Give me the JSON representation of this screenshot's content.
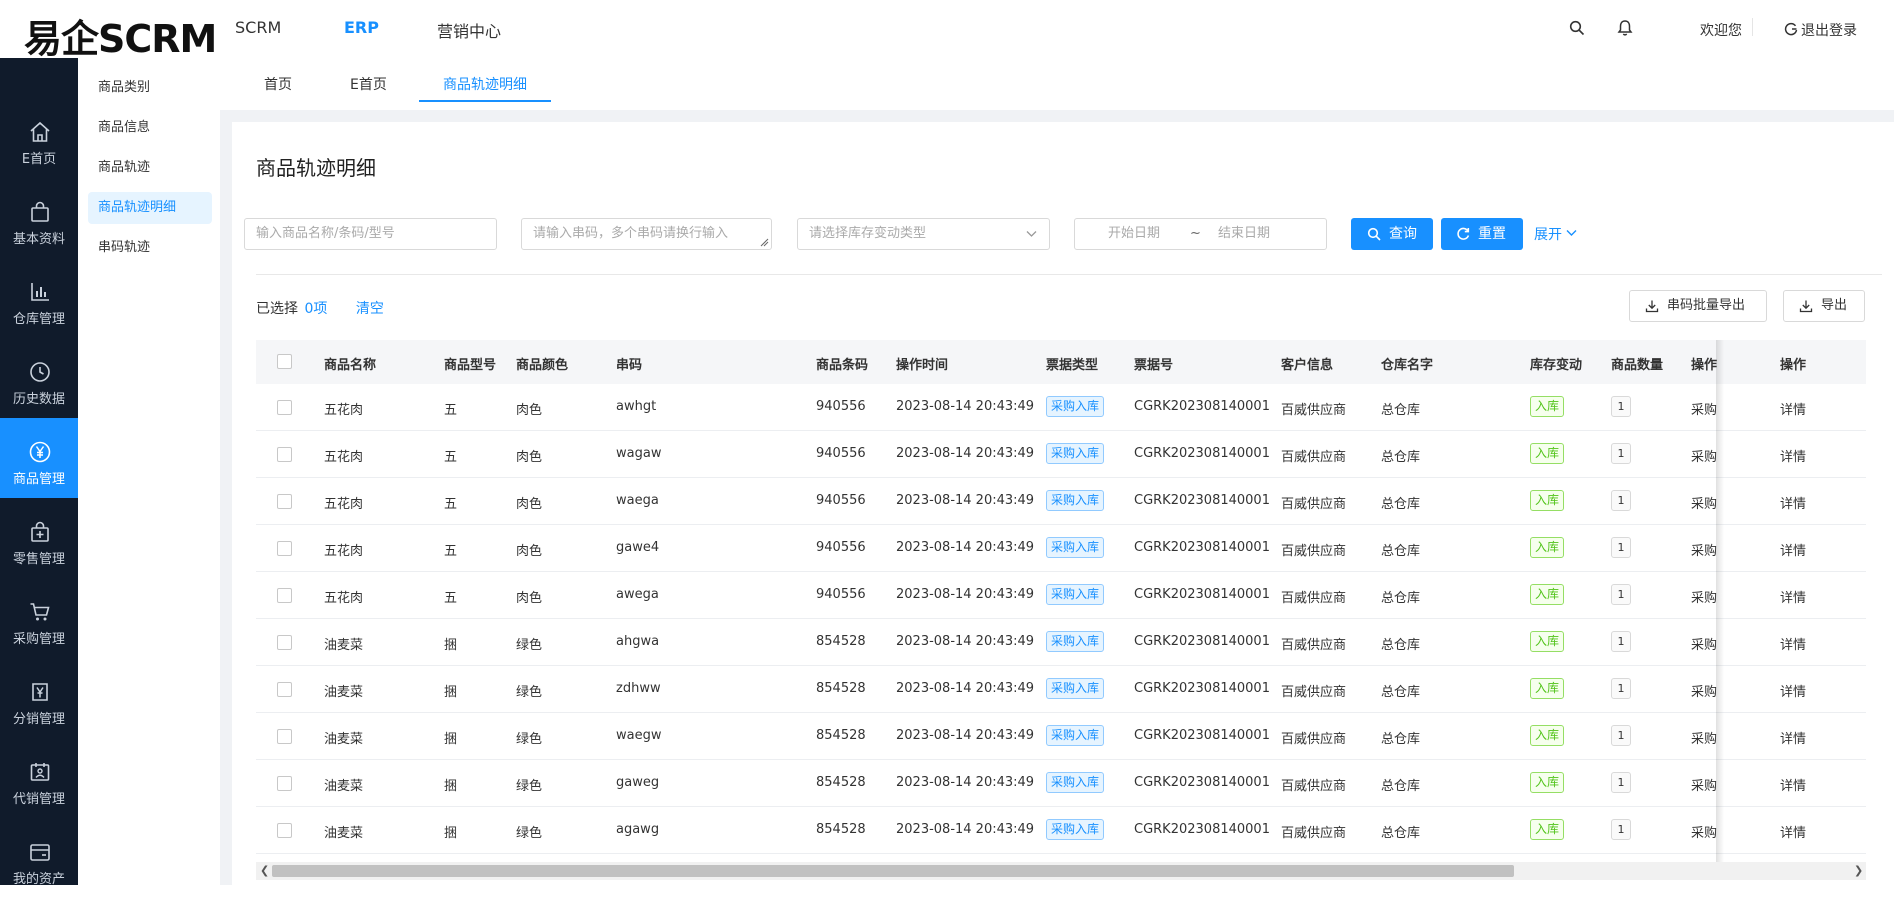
{
  "app": {
    "logo": "易企SCRM",
    "topnav": [
      "SCRM",
      "ERP",
      "营销中心"
    ],
    "welcome": "欢迎您",
    "logout": "退出登录"
  },
  "sidebar": {
    "items": [
      {
        "label": "E首页",
        "icon": "home-icon"
      },
      {
        "label": "基本资料",
        "icon": "bag-icon"
      },
      {
        "label": "仓库管理",
        "icon": "bar-chart-icon"
      },
      {
        "label": "历史数据",
        "icon": "clock-icon"
      },
      {
        "label": "商品管理",
        "icon": "yen-circle-icon"
      },
      {
        "label": "零售管理",
        "icon": "retail-bag-icon"
      },
      {
        "label": "采购管理",
        "icon": "cart-icon"
      },
      {
        "label": "分销管理",
        "icon": "yen-box-icon"
      },
      {
        "label": "代销管理",
        "icon": "calendar-user-icon"
      },
      {
        "label": "我的资产",
        "icon": "wallet-icon"
      }
    ]
  },
  "submenu": {
    "items": [
      "商品类别",
      "商品信息",
      "商品轨迹",
      "商品轨迹明细",
      "串码轨迹"
    ]
  },
  "tabs": [
    "首页",
    "E首页",
    "商品轨迹明细"
  ],
  "page": {
    "title": "商品轨迹明细",
    "filters": {
      "product_placeholder": "输入商品名称/条码/型号",
      "serial_placeholder": "请输入串码，多个串码请换行输入",
      "type_placeholder": "请选择库存变动类型",
      "start_date_placeholder": "开始日期",
      "date_sep": "~",
      "end_date_placeholder": "结束日期"
    },
    "buttons": {
      "query": "查询",
      "reset": "重置",
      "expand": "展开",
      "serial_export": "串码批量导出",
      "export": "导出",
      "clear": "清空"
    },
    "selected_prefix": "已选择",
    "selected_count": "0项"
  },
  "table": {
    "columns": [
      "商品名称",
      "商品型号",
      "商品颜色",
      "串码",
      "商品条码",
      "操作时间",
      "票据类型",
      "票据号",
      "客户信息",
      "仓库名字",
      "库存变动",
      "商品数量",
      "操作",
      "操作"
    ],
    "rows": [
      {
        "name": "五花肉",
        "model": "五",
        "color": "肉色",
        "serial": "awhgt",
        "barcode": "940556",
        "time": "2023-08-14 20:43:49",
        "bill_type": "采购入库",
        "bill_no": "CGRK202308140001",
        "customer": "百威供应商",
        "warehouse": "总仓库",
        "change": "入库",
        "qty": "1",
        "op": "采购",
        "action": "详情"
      },
      {
        "name": "五花肉",
        "model": "五",
        "color": "肉色",
        "serial": "wagaw",
        "barcode": "940556",
        "time": "2023-08-14 20:43:49",
        "bill_type": "采购入库",
        "bill_no": "CGRK202308140001",
        "customer": "百威供应商",
        "warehouse": "总仓库",
        "change": "入库",
        "qty": "1",
        "op": "采购",
        "action": "详情"
      },
      {
        "name": "五花肉",
        "model": "五",
        "color": "肉色",
        "serial": "waega",
        "barcode": "940556",
        "time": "2023-08-14 20:43:49",
        "bill_type": "采购入库",
        "bill_no": "CGRK202308140001",
        "customer": "百威供应商",
        "warehouse": "总仓库",
        "change": "入库",
        "qty": "1",
        "op": "采购",
        "action": "详情"
      },
      {
        "name": "五花肉",
        "model": "五",
        "color": "肉色",
        "serial": "gawe4",
        "barcode": "940556",
        "time": "2023-08-14 20:43:49",
        "bill_type": "采购入库",
        "bill_no": "CGRK202308140001",
        "customer": "百威供应商",
        "warehouse": "总仓库",
        "change": "入库",
        "qty": "1",
        "op": "采购",
        "action": "详情"
      },
      {
        "name": "五花肉",
        "model": "五",
        "color": "肉色",
        "serial": "awega",
        "barcode": "940556",
        "time": "2023-08-14 20:43:49",
        "bill_type": "采购入库",
        "bill_no": "CGRK202308140001",
        "customer": "百威供应商",
        "warehouse": "总仓库",
        "change": "入库",
        "qty": "1",
        "op": "采购",
        "action": "详情"
      },
      {
        "name": "油麦菜",
        "model": "捆",
        "color": "绿色",
        "serial": "ahgwa",
        "barcode": "854528",
        "time": "2023-08-14 20:43:49",
        "bill_type": "采购入库",
        "bill_no": "CGRK202308140001",
        "customer": "百威供应商",
        "warehouse": "总仓库",
        "change": "入库",
        "qty": "1",
        "op": "采购",
        "action": "详情"
      },
      {
        "name": "油麦菜",
        "model": "捆",
        "color": "绿色",
        "serial": "zdhww",
        "barcode": "854528",
        "time": "2023-08-14 20:43:49",
        "bill_type": "采购入库",
        "bill_no": "CGRK202308140001",
        "customer": "百威供应商",
        "warehouse": "总仓库",
        "change": "入库",
        "qty": "1",
        "op": "采购",
        "action": "详情"
      },
      {
        "name": "油麦菜",
        "model": "捆",
        "color": "绿色",
        "serial": "waegw",
        "barcode": "854528",
        "time": "2023-08-14 20:43:49",
        "bill_type": "采购入库",
        "bill_no": "CGRK202308140001",
        "customer": "百威供应商",
        "warehouse": "总仓库",
        "change": "入库",
        "qty": "1",
        "op": "采购",
        "action": "详情"
      },
      {
        "name": "油麦菜",
        "model": "捆",
        "color": "绿色",
        "serial": "gaweg",
        "barcode": "854528",
        "time": "2023-08-14 20:43:49",
        "bill_type": "采购入库",
        "bill_no": "CGRK202308140001",
        "customer": "百威供应商",
        "warehouse": "总仓库",
        "change": "入库",
        "qty": "1",
        "op": "采购",
        "action": "详情"
      },
      {
        "name": "油麦菜",
        "model": "捆",
        "color": "绿色",
        "serial": "agawg",
        "barcode": "854528",
        "time": "2023-08-14 20:43:49",
        "bill_type": "采购入库",
        "bill_no": "CGRK202308140001",
        "customer": "百威供应商",
        "warehouse": "总仓库",
        "change": "入库",
        "qty": "1",
        "op": "采购",
        "action": "详情"
      }
    ]
  },
  "colors": {
    "accent": "#1890ff",
    "sidebar_bg": "#101b2b",
    "success": "#52c41a"
  }
}
